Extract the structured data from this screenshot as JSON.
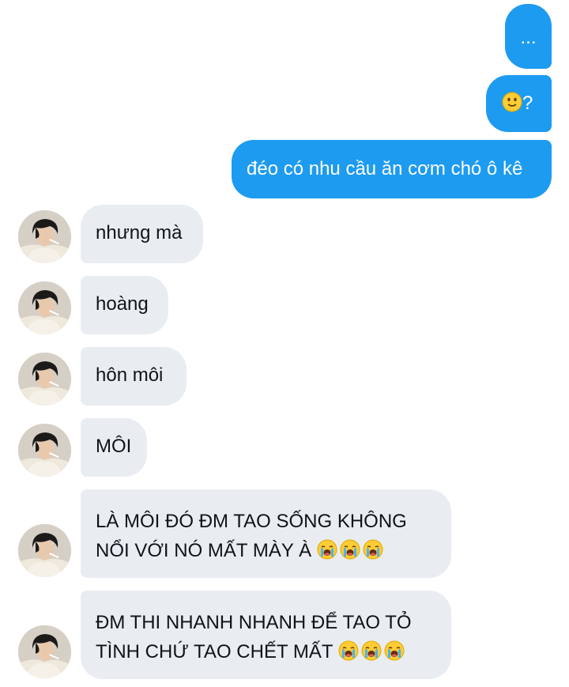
{
  "conversation": {
    "outgoing": [
      {
        "text": "..."
      },
      {
        "text": "?",
        "emoji": "slightly-smiling-face"
      },
      {
        "text": "đéo có nhu cầu ăn cơm chó ô kê"
      }
    ],
    "incoming": [
      {
        "text": "nhưng mà"
      },
      {
        "text": "hoàng"
      },
      {
        "text": "hôn môi"
      },
      {
        "text": "MÔI"
      },
      {
        "lines": [
          "LÀ MÔI ĐÓ ĐM TAO SỐNG KHÔNG",
          "NỔI VỚI NÓ MẤT MÀY À"
        ],
        "emoji": [
          "loudly-crying-face",
          "loudly-crying-face",
          "loudly-crying-face"
        ]
      },
      {
        "lines": [
          "ĐM THI NHANH NHANH ĐỂ TAO TỎ",
          "TÌNH CHỨ TAO CHẾT MẤT"
        ],
        "emoji": [
          "loudly-crying-face",
          "loudly-crying-face",
          "loudly-crying-face"
        ]
      }
    ]
  },
  "colors": {
    "outgoing_bubble": "#1d9bf0",
    "incoming_bubble": "#e9edf1",
    "outgoing_text": "#ffffff",
    "incoming_text": "#0f1419"
  }
}
